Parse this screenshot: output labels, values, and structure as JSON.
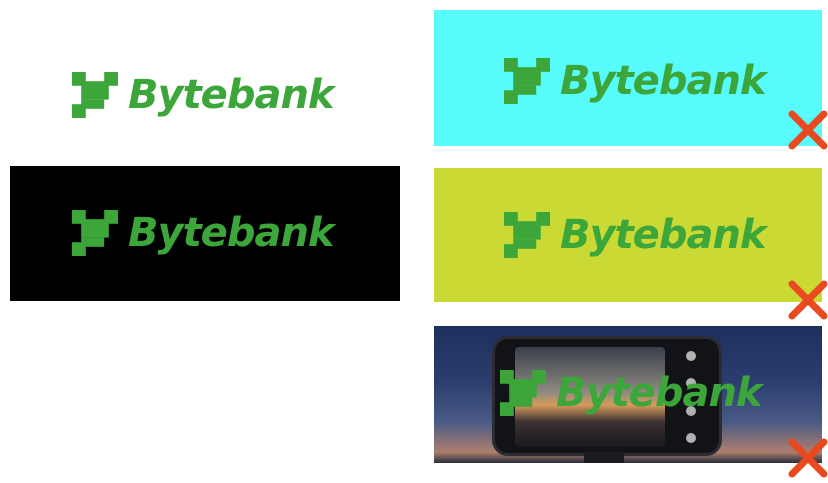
{
  "brand": {
    "name": "Bytebank",
    "green": "#3da63b",
    "icon": "bytebank-pixel-logo-icon"
  },
  "variants": [
    {
      "id": "white",
      "background": "#ffffff",
      "allowed": true
    },
    {
      "id": "black",
      "background": "#000000",
      "allowed": true
    },
    {
      "id": "cyan",
      "background": "#58fbfb",
      "allowed": false
    },
    {
      "id": "yellow",
      "background": "#cbd934",
      "allowed": false
    },
    {
      "id": "photo",
      "background": "photo",
      "allowed": false
    }
  ],
  "marks": {
    "cross_color": "#e8491f",
    "cross_icon": "x-mark-icon"
  }
}
